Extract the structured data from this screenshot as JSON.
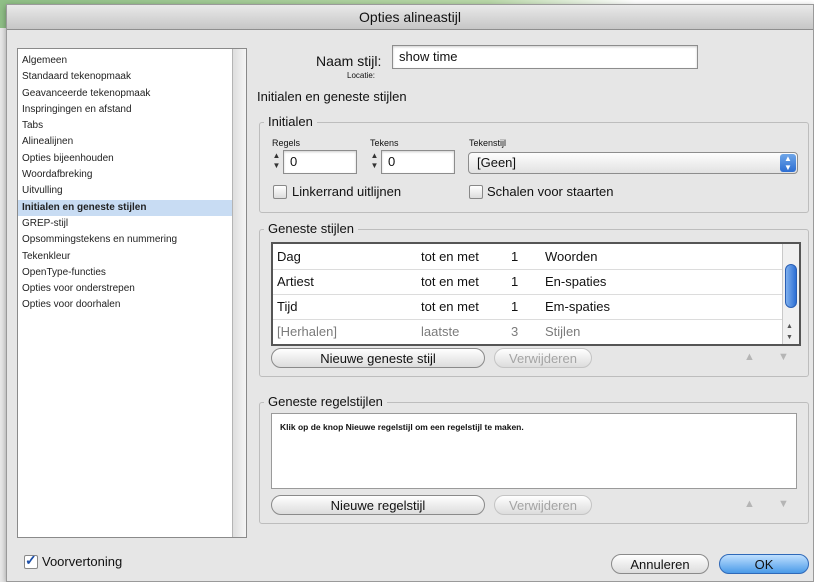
{
  "window": {
    "title": "Opties alineastijl"
  },
  "sidebar": {
    "items": [
      {
        "label": "Algemeen"
      },
      {
        "label": "Standaard tekenopmaak"
      },
      {
        "label": "Geavanceerde tekenopmaak"
      },
      {
        "label": "Inspringingen en afstand"
      },
      {
        "label": "Tabs"
      },
      {
        "label": "Alinealijnen"
      },
      {
        "label": "Opties bijeenhouden"
      },
      {
        "label": "Woordafbreking"
      },
      {
        "label": "Uitvulling"
      },
      {
        "label": "Initialen en geneste stijlen",
        "selected": true
      },
      {
        "label": "GREP-stijl"
      },
      {
        "label": "Opsommingstekens en nummering"
      },
      {
        "label": "Tekenkleur"
      },
      {
        "label": "OpenType-functies"
      },
      {
        "label": "Opties voor onderstrepen"
      },
      {
        "label": "Opties voor doorhalen"
      }
    ]
  },
  "header": {
    "style_name_label": "Naam stijl:",
    "style_name_value": "show time",
    "location_label": "Locatie:",
    "section_title": "Initialen en geneste stijlen"
  },
  "initials": {
    "title": "Initialen",
    "lines_label": "Regels",
    "lines_value": "0",
    "chars_label": "Tekens",
    "chars_value": "0",
    "charstyle_label": "Tekenstijl",
    "charstyle_value": "[Geen]",
    "align_left_label": "Linkerrand uitlijnen",
    "scale_label": "Schalen voor staarten"
  },
  "nested": {
    "title": "Geneste stijlen",
    "rows": [
      {
        "style": "Dag",
        "op": "tot en met",
        "count": "1",
        "unit": "Woorden"
      },
      {
        "style": "Artiest",
        "op": "tot en met",
        "count": "1",
        "unit": "En-spaties"
      },
      {
        "style": "Tijd",
        "op": "tot en met",
        "count": "1",
        "unit": "Em-spaties"
      },
      {
        "style": "[Herhalen]",
        "op": "laatste",
        "count": "3",
        "unit": "Stijlen"
      }
    ],
    "new_button": "Nieuwe geneste stijl",
    "delete_button": "Verwijderen"
  },
  "nested_line": {
    "title": "Geneste regelstijlen",
    "hint": "Klik op de knop Nieuwe regelstijl om een regelstijl te maken.",
    "new_button": "Nieuwe regelstijl",
    "delete_button": "Verwijderen"
  },
  "footer": {
    "preview_label": "Voorvertoning",
    "cancel_button": "Annuleren",
    "ok_button": "OK"
  },
  "colors": {
    "selection": "#c8dcf3",
    "accent": "#2c6dd2"
  }
}
